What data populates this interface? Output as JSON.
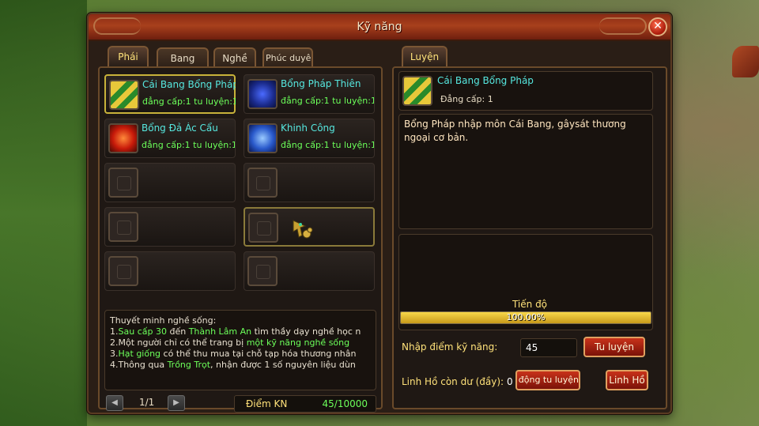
{
  "window": {
    "title": "Kỹ năng"
  },
  "left_tabs": [
    {
      "label": "Phái",
      "active": true
    },
    {
      "label": "Bang hội",
      "active": false
    },
    {
      "label": "Nghề",
      "active": false
    },
    {
      "label": "Phúc duyên",
      "active": false
    }
  ],
  "skills": [
    {
      "name": "Cái Bang Bổng Pháp",
      "level": "đẳng cấp:1",
      "progress": "tu luyện:1(",
      "icon": "staff-icon",
      "selected": true
    },
    {
      "name": "Bổng Pháp Thiên",
      "level": "đẳng cấp:1",
      "progress": "tu luyện:1(",
      "icon": "blue-scroll-icon",
      "selected": false
    },
    {
      "name": "Bổng Đả Ác Cẩu",
      "level": "đẳng cấp:1",
      "progress": "tu luyện:1(",
      "icon": "crossed-staves-icon",
      "selected": false
    },
    {
      "name": "Khinh Công",
      "level": "đẳng cấp:1",
      "progress": "tu luyện:1(",
      "icon": "swirl-icon",
      "selected": false
    }
  ],
  "description": {
    "heading": "Thuyết minh nghề sống:",
    "lines": [
      {
        "pre": "1.",
        "hl1": "Sau cấp 30",
        "mid": " đến ",
        "hl2": "Thành Lâm An",
        "post": " tìm thầy dạy nghề học n"
      },
      {
        "pre": "2.Một người chỉ có thể trang bị ",
        "hl1": "một kỹ năng nghề sống",
        "mid": "",
        "hl2": "",
        "post": ""
      },
      {
        "pre": "3.",
        "hl1": "Hạt giống",
        "mid": " có thể thu mua tại chỗ tạp hóa thương nhân",
        "hl2": "",
        "post": ""
      },
      {
        "pre": "4.Thông qua ",
        "hl1": "Trồng Trọt",
        "mid": ", nhận được 1 số nguyên liệu dùn",
        "hl2": "",
        "post": ""
      }
    ]
  },
  "pager": {
    "page": "1/1",
    "prev_icon": "prev-arrow-icon",
    "next_icon": "next-arrow-icon"
  },
  "points": {
    "label": "Điểm KN",
    "value": "45/10000"
  },
  "right_tab": {
    "label": "Luyện"
  },
  "selected_skill": {
    "name": "Cái Bang Bổng Pháp",
    "level": "Đẳng cấp: 1",
    "icon": "staff-icon",
    "description": "Bổng Pháp nhập môn Cái Bang, gâysát thương ngoại cơ bản."
  },
  "progress": {
    "label": "Tiến độ",
    "value_text": "100.00%",
    "fraction": 1.0
  },
  "train": {
    "points_label": "Nhập điểm kỹ năng:",
    "points_value": "45",
    "train_button": "Tu luyện",
    "spirit_label": "Linh Hồ còn dư (đầy):",
    "spirit_value": "0",
    "auto_button": "Tự động tu luyện",
    "spirit_button": "Linh Hồ"
  },
  "colors": {
    "skill_name": "#56e8e0",
    "highlight": "#6cff5a",
    "accent_gold": "#ffe27a",
    "title_bar": "#a8401c"
  }
}
